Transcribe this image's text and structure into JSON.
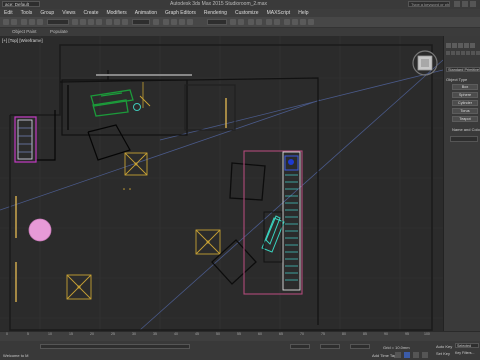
{
  "title_bar": {
    "workspace": "ace: Default",
    "title": "Autodesk 3ds Max 2015    Studioroom_2.max",
    "search_placeholder": "Type a keyword or phrase"
  },
  "menus": [
    "Edit",
    "Tools",
    "Group",
    "Views",
    "Create",
    "Modifiers",
    "Animation",
    "Graph Editors",
    "Rendering",
    "Customize",
    "MAXScript",
    "Help"
  ],
  "ribbon": {
    "labels": [
      "Object Paint",
      "Populate"
    ]
  },
  "viewport": {
    "label": "[+] [Top] [Wireframe]"
  },
  "command_panel": {
    "dropdown": "Standard Primitives",
    "section_object_type": "Object Type",
    "buttons": [
      "Box",
      "Sphere",
      "Cylinder",
      "Torus",
      "Teapot"
    ],
    "section_name_color": "Name and Color"
  },
  "timeline": {
    "ticks": [
      "0",
      "5",
      "10",
      "15",
      "20",
      "25",
      "30",
      "35",
      "40",
      "45",
      "50",
      "55",
      "60",
      "65",
      "70",
      "75",
      "80",
      "85",
      "90",
      "95",
      "100"
    ]
  },
  "status": {
    "welcome": "Welcome to M",
    "grid": "Grid = 10.0mm",
    "add_time_tag": "Add Time Tag",
    "auto_key": "Auto Key",
    "selected": "Selected",
    "set_key": "Set Key",
    "key_filters": "Key Filters..."
  }
}
